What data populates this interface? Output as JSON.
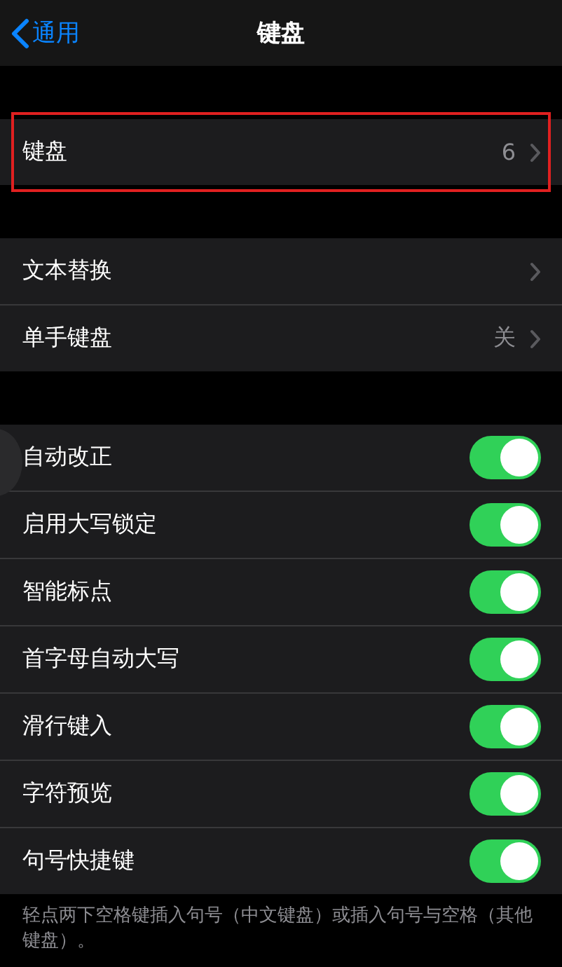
{
  "nav": {
    "back": "通用",
    "title": "键盘"
  },
  "groups": [
    {
      "rows": [
        {
          "kind": "link",
          "label": "键盘",
          "value": "6",
          "highlighted": true
        }
      ]
    },
    {
      "rows": [
        {
          "kind": "link",
          "label": "文本替换",
          "highlighted": false
        },
        {
          "kind": "link",
          "label": "单手键盘",
          "value": "关",
          "highlighted": false
        }
      ]
    },
    {
      "rows": [
        {
          "kind": "toggle",
          "label": "自动改正",
          "on": true
        },
        {
          "kind": "toggle",
          "label": "启用大写锁定",
          "on": true
        },
        {
          "kind": "toggle",
          "label": "智能标点",
          "on": true
        },
        {
          "kind": "toggle",
          "label": "首字母自动大写",
          "on": true
        },
        {
          "kind": "toggle",
          "label": "滑行键入",
          "on": true
        },
        {
          "kind": "toggle",
          "label": "字符预览",
          "on": true
        },
        {
          "kind": "toggle",
          "label": "句号快捷键",
          "on": true
        }
      ],
      "footer": "轻点两下空格键插入句号（中文键盘）或插入句号与空格（其他键盘）。"
    }
  ]
}
